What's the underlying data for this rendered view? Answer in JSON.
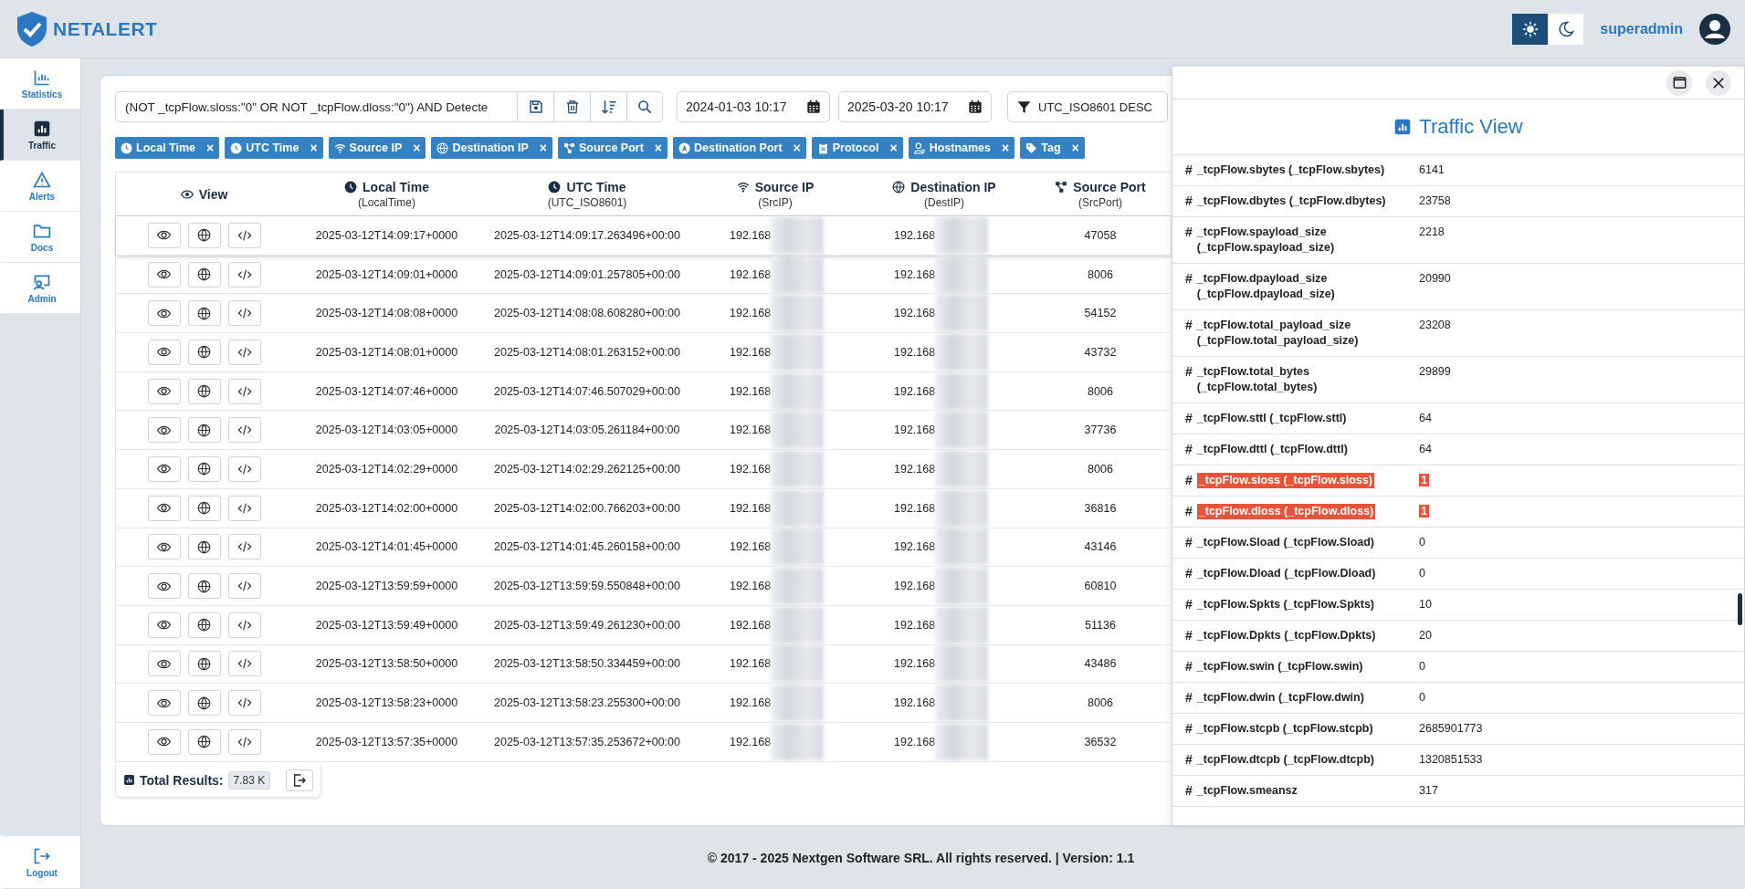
{
  "app": {
    "logo_text": "NETALERT",
    "user": "superadmin",
    "theme": [
      {
        "kind": "light",
        "selected": true
      },
      {
        "kind": "dark",
        "selected": false
      }
    ]
  },
  "sidebar": {
    "items": [
      {
        "label": "Statistics",
        "selected": false
      },
      {
        "label": "Traffic",
        "selected": true
      },
      {
        "label": "Alerts",
        "selected": false
      },
      {
        "label": "Docs",
        "selected": false
      },
      {
        "label": "Admin",
        "selected": false
      }
    ],
    "logout": "Logout"
  },
  "query": {
    "value": "(NOT _tcpFlow.sloss:\"0\" OR NOT _tcpFlow.dloss:\"0\") AND Detecte",
    "date_from": "2024-01-03 10:17",
    "date_to": "2025-03-20 10:17",
    "sort": "UTC_ISO8601 DESC"
  },
  "column_chips": [
    {
      "label": "Local Time",
      "remove": "×"
    },
    {
      "label": "UTC Time",
      "remove": "×"
    },
    {
      "label": "Source IP",
      "remove": "×"
    },
    {
      "label": "Destination IP",
      "remove": "×"
    },
    {
      "label": "Source Port",
      "remove": "×"
    },
    {
      "label": "Destination Port",
      "remove": "×"
    },
    {
      "label": "Protocol",
      "remove": "×"
    },
    {
      "label": "Hostnames",
      "remove": "×"
    },
    {
      "label": "Tag",
      "remove": "×"
    }
  ],
  "table": {
    "columns": [
      {
        "label": "View"
      },
      {
        "label": "Local Time",
        "field": "(LocalTime)"
      },
      {
        "label": "UTC Time",
        "field": "(UTC_ISO8601)"
      },
      {
        "label": "Source IP",
        "field": "(SrcIP)"
      },
      {
        "label": "Destination IP",
        "field": "(DestIP)"
      },
      {
        "label": "Source Port",
        "field": "(SrcPort)"
      }
    ],
    "rows": [
      {
        "selected": true,
        "local": "2025-03-12T14:09:17+0000",
        "utc": "2025-03-12T14:09:17.263496+00:00",
        "src": "192.168",
        "dst": "192.168",
        "sport": "47058"
      },
      {
        "selected": false,
        "local": "2025-03-12T14:09:01+0000",
        "utc": "2025-03-12T14:09:01.257805+00:00",
        "src": "192.168",
        "dst": "192.168",
        "sport": "8006"
      },
      {
        "selected": false,
        "local": "2025-03-12T14:08:08+0000",
        "utc": "2025-03-12T14:08:08.608280+00:00",
        "src": "192.168",
        "dst": "192.168",
        "sport": "54152"
      },
      {
        "selected": false,
        "local": "2025-03-12T14:08:01+0000",
        "utc": "2025-03-12T14:08:01.263152+00:00",
        "src": "192.168",
        "dst": "192.168",
        "sport": "43732"
      },
      {
        "selected": false,
        "local": "2025-03-12T14:07:46+0000",
        "utc": "2025-03-12T14:07:46.507029+00:00",
        "src": "192.168",
        "dst": "192.168",
        "sport": "8006"
      },
      {
        "selected": false,
        "local": "2025-03-12T14:03:05+0000",
        "utc": "2025-03-12T14:03:05.261184+00:00",
        "src": "192.168",
        "dst": "192.168",
        "sport": "37736"
      },
      {
        "selected": false,
        "local": "2025-03-12T14:02:29+0000",
        "utc": "2025-03-12T14:02:29.262125+00:00",
        "src": "192.168",
        "dst": "192.168",
        "sport": "8006"
      },
      {
        "selected": false,
        "local": "2025-03-12T14:02:00+0000",
        "utc": "2025-03-12T14:02:00.766203+00:00",
        "src": "192.168",
        "dst": "192.168",
        "sport": "36816"
      },
      {
        "selected": false,
        "local": "2025-03-12T14:01:45+0000",
        "utc": "2025-03-12T14:01:45.260158+00:00",
        "src": "192.168",
        "dst": "192.168",
        "sport": "43146"
      },
      {
        "selected": false,
        "local": "2025-03-12T13:59:59+0000",
        "utc": "2025-03-12T13:59:59.550848+00:00",
        "src": "192.168",
        "dst": "192.168",
        "sport": "60810"
      },
      {
        "selected": false,
        "local": "2025-03-12T13:59:49+0000",
        "utc": "2025-03-12T13:59:49.261230+00:00",
        "src": "192.168",
        "dst": "192.168",
        "sport": "51136"
      },
      {
        "selected": false,
        "local": "2025-03-12T13:58:50+0000",
        "utc": "2025-03-12T13:58:50.334459+00:00",
        "src": "192.168",
        "dst": "192.168",
        "sport": "43486"
      },
      {
        "selected": false,
        "local": "2025-03-12T13:58:23+0000",
        "utc": "2025-03-12T13:58:23.255300+00:00",
        "src": "192.168",
        "dst": "192.168",
        "sport": "8006"
      },
      {
        "selected": false,
        "local": "2025-03-12T13:57:35+0000",
        "utc": "2025-03-12T13:57:35.253672+00:00",
        "src": "192.168",
        "dst": "192.168",
        "sport": "36532"
      }
    ],
    "total_label": "Total Results:",
    "total": "7.83 K"
  },
  "detail_panel": {
    "title": "Traffic View",
    "fields": [
      {
        "hash": "#",
        "name": "_tcpFlow.sbytes (_tcpFlow.sbytes)",
        "value": "6141",
        "highlighted": false
      },
      {
        "hash": "#",
        "name": "_tcpFlow.dbytes (_tcpFlow.dbytes)",
        "value": "23758",
        "highlighted": false
      },
      {
        "hash": "#",
        "name": "_tcpFlow.spayload_size (_tcpFlow.spayload_size)",
        "value": "2218",
        "highlighted": false
      },
      {
        "hash": "#",
        "name": "_tcpFlow.dpayload_size (_tcpFlow.dpayload_size)",
        "value": "20990",
        "highlighted": false
      },
      {
        "hash": "#",
        "name": "_tcpFlow.total_payload_size (_tcpFlow.total_payload_size)",
        "value": "23208",
        "highlighted": false
      },
      {
        "hash": "#",
        "name": "_tcpFlow.total_bytes (_tcpFlow.total_bytes)",
        "value": "29899",
        "highlighted": false
      },
      {
        "hash": "#",
        "name": "_tcpFlow.sttl (_tcpFlow.sttl)",
        "value": "64",
        "highlighted": false
      },
      {
        "hash": "#",
        "name": "_tcpFlow.dttl (_tcpFlow.dttl)",
        "value": "64",
        "highlighted": false
      },
      {
        "hash": "#",
        "name": "_tcpFlow.sloss (_tcpFlow.sloss)",
        "value": "1",
        "highlighted": true
      },
      {
        "hash": "#",
        "name": "_tcpFlow.dloss (_tcpFlow.dloss)",
        "value": "1",
        "highlighted": true
      },
      {
        "hash": "#",
        "name": "_tcpFlow.Sload (_tcpFlow.Sload)",
        "value": "0",
        "highlighted": false
      },
      {
        "hash": "#",
        "name": "_tcpFlow.Dload (_tcpFlow.Dload)",
        "value": "0",
        "highlighted": false
      },
      {
        "hash": "#",
        "name": "_tcpFlow.Spkts (_tcpFlow.Spkts)",
        "value": "10",
        "highlighted": false
      },
      {
        "hash": "#",
        "name": "_tcpFlow.Dpkts (_tcpFlow.Dpkts)",
        "value": "20",
        "highlighted": false
      },
      {
        "hash": "#",
        "name": "_tcpFlow.swin (_tcpFlow.swin)",
        "value": "0",
        "highlighted": false
      },
      {
        "hash": "#",
        "name": "_tcpFlow.dwin (_tcpFlow.dwin)",
        "value": "0",
        "highlighted": false
      },
      {
        "hash": "#",
        "name": "_tcpFlow.stcpb (_tcpFlow.stcpb)",
        "value": "2685901773",
        "highlighted": false
      },
      {
        "hash": "#",
        "name": "_tcpFlow.dtcpb (_tcpFlow.dtcpb)",
        "value": "1320851533",
        "highlighted": false
      },
      {
        "hash": "#",
        "name": "_tcpFlow.smeansz",
        "value": "317",
        "highlighted": false
      }
    ]
  },
  "footer": "© 2017 - 2025 Nextgen Software SRL. All rights reserved. | Version: 1.1"
}
